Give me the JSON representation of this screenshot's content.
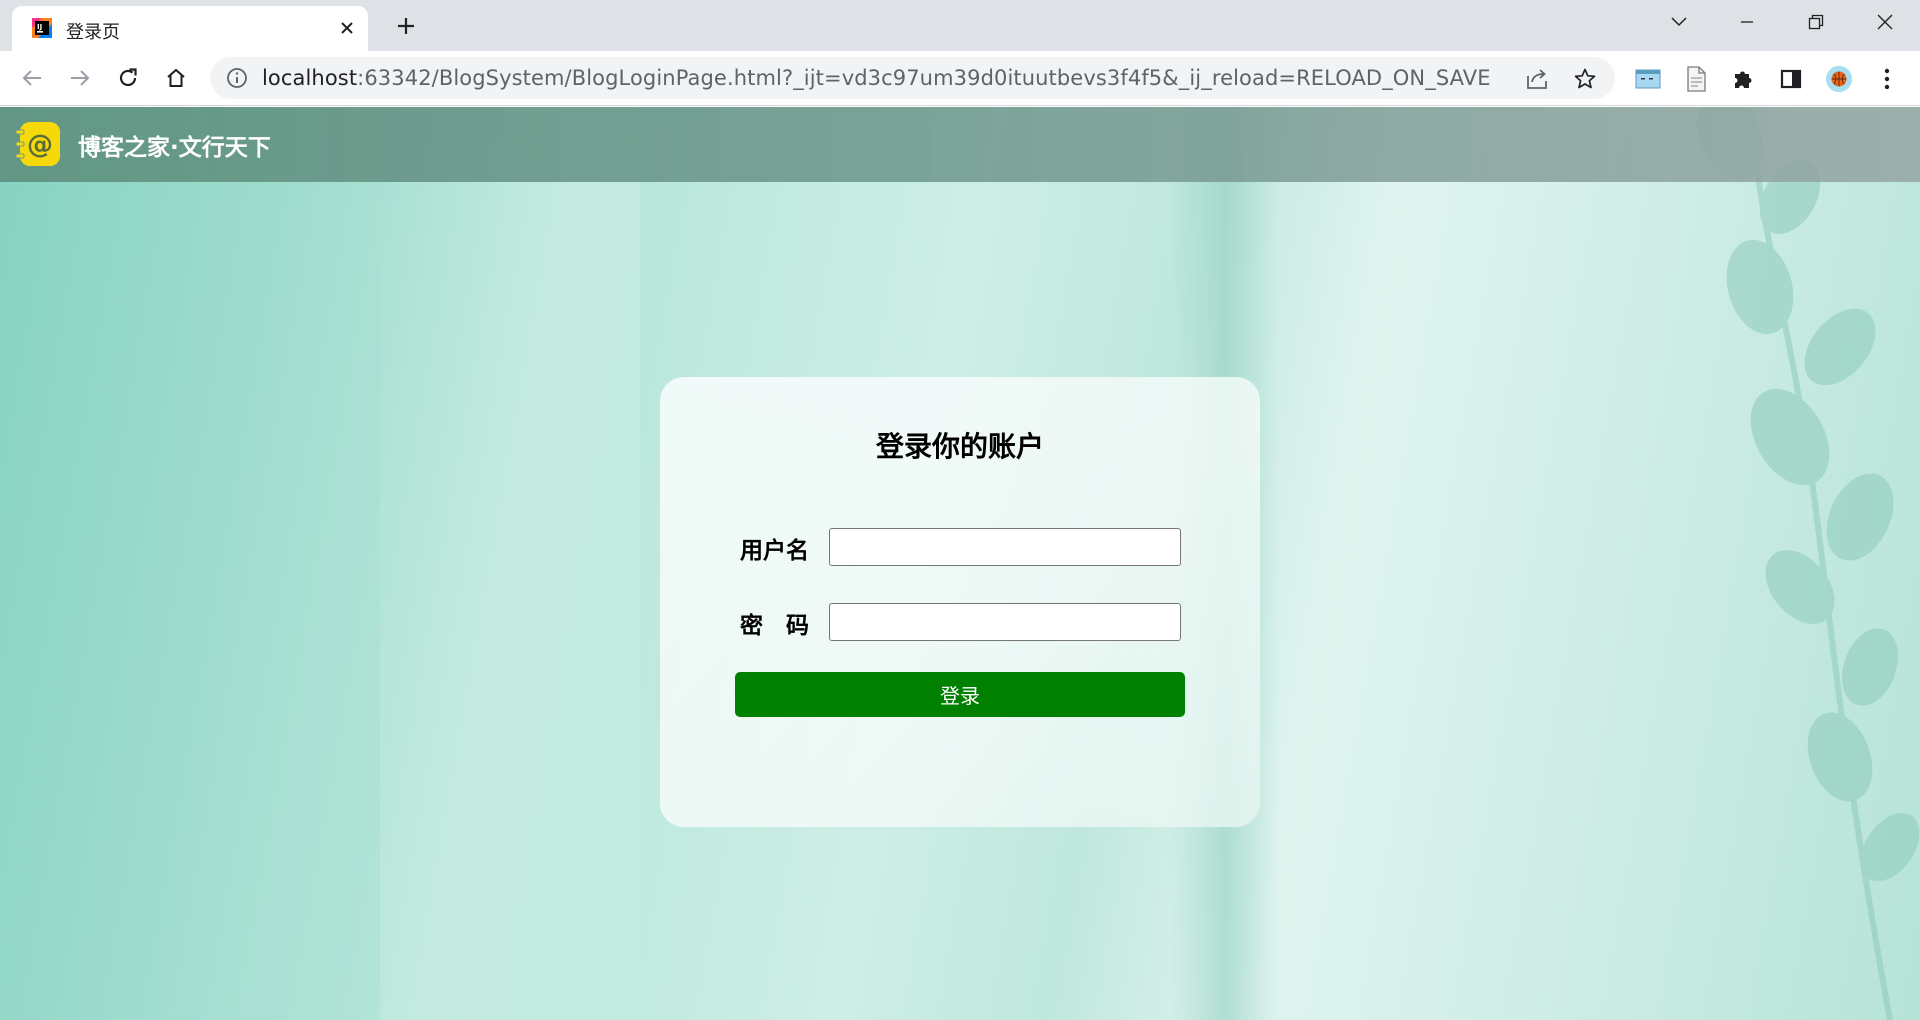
{
  "browser": {
    "tab_title": "登录页",
    "url_host": "localhost",
    "url_rest": ":63342/BlogSystem/BlogLoginPage.html?_ijt=vd3c97um39d0ituutbevs3f4f5&_ij_reload=RELOAD_ON_SAVE"
  },
  "header": {
    "site_title": "博客之家·文行天下"
  },
  "login": {
    "title": "登录你的账户",
    "username_label": "用户名",
    "password_label": "密　码",
    "username_value": "",
    "password_value": "",
    "button_label": "登录"
  },
  "colors": {
    "button_green": "#008000",
    "logo_yellow": "#f5d90a",
    "nav_bar": "#6f9a8c"
  }
}
